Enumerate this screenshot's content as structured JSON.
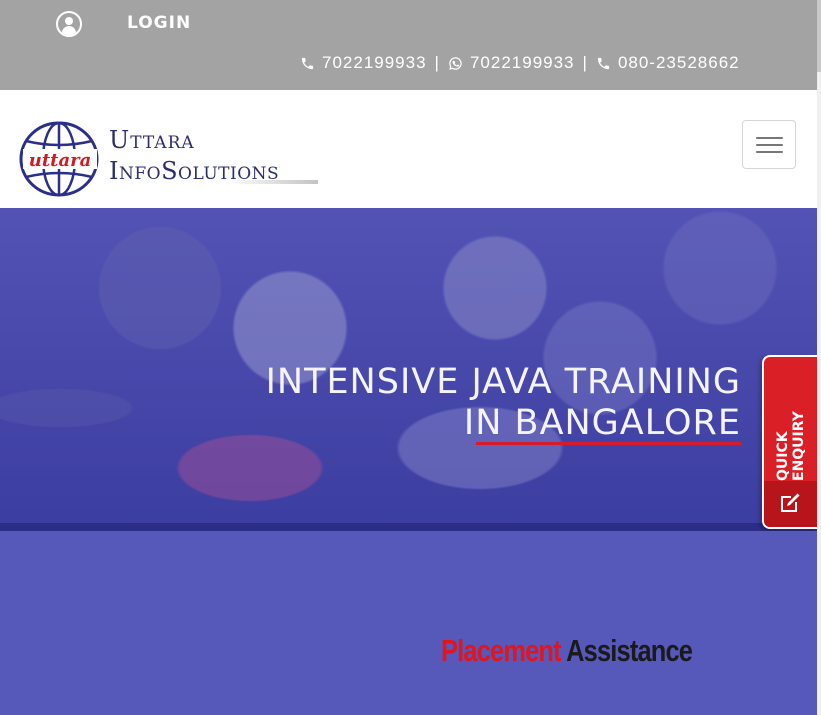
{
  "topbar": {
    "login_label": "LOGIN",
    "icons": [
      "user-circle-icon",
      "phone-icon",
      "whatsapp-icon",
      "phone-icon"
    ],
    "phone_1": "7022199933",
    "whatsapp": "7022199933",
    "phone_2": "080-23528662",
    "separator": "|",
    "background_color": "#a3a3a3"
  },
  "header": {
    "logo_text": "uttara",
    "brand_line1": "Uttara",
    "brand_line2": "InfoSolutions",
    "brand_color": "#2b2e6e",
    "menu_icon": "hamburger-menu-icon"
  },
  "hero": {
    "title_line1": "INTENSIVE JAVA TRAINING",
    "title_line2": "IN BANGALORE",
    "underline_color": "#d61b2c"
  },
  "quick_enquiry": {
    "label_line1": "QUICK",
    "label_line2": "ENQUIRY",
    "icon": "edit-icon",
    "color": "#da1f26"
  },
  "section": {
    "heading_red": "Placement",
    "heading_dark": "Assistance",
    "background_color": "#5659b9"
  }
}
